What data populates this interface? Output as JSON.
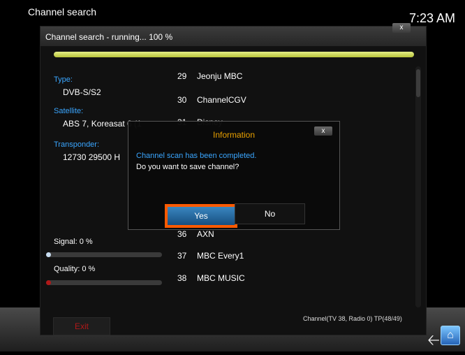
{
  "window": {
    "title": "Channel search",
    "clock": "7:23 AM"
  },
  "dialog": {
    "title": "Channel search - running... 100 %",
    "close_label": "x",
    "progress": 1.0,
    "type_label": "Type:",
    "type_value": "DVB-S/S2",
    "satellite_label": "Satellite:",
    "satellite_value": "ABS 7, Koreasat 6 (1",
    "transponder_label": "Transponder:",
    "transponder_value": "12730 29500 H",
    "signal_label": "Signal: 0 %",
    "signal_level": 0.0,
    "quality_label": "Quality: 0 %",
    "quality_level": 0.0,
    "exit_label": "Exit",
    "footer": "Channel(TV 38, Radio 0) TP(48/49)",
    "channels": [
      {
        "num": "29",
        "name": "Jeonju MBC"
      },
      {
        "num": "30",
        "name": "ChannelCGV"
      },
      {
        "num": "31",
        "name": "Disney"
      },
      {
        "num": "36",
        "name": "AXN"
      },
      {
        "num": "37",
        "name": "MBC Every1"
      },
      {
        "num": "38",
        "name": "MBC MUSIC"
      }
    ]
  },
  "info": {
    "title": "Information",
    "close_label": "x",
    "message1": "Channel scan has been completed.",
    "message2": "Do you want to save channel?",
    "yes_label": "Yes",
    "no_label": "No"
  },
  "icons": {
    "back": "back-arrow-icon",
    "home": "home-icon"
  },
  "colors": {
    "accent_blue": "#3aa6ff",
    "highlight": "#ff5a00",
    "info_title": "#e8a000",
    "exit": "#b01818"
  }
}
